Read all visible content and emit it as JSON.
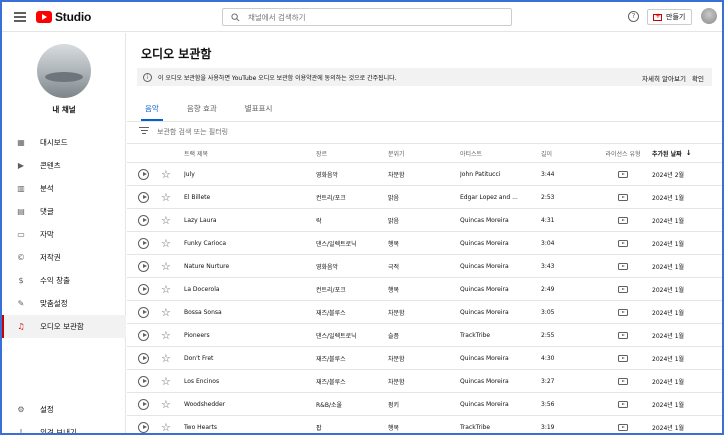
{
  "topbar": {
    "logo_text": "Studio",
    "search_placeholder": "채널에서 검색하기",
    "help": "?",
    "create_label": "만들기"
  },
  "sidebar": {
    "channel_name": "내 채널",
    "items": [
      {
        "label": "대시보드",
        "icon": "dashboard-icon"
      },
      {
        "label": "콘텐츠",
        "icon": "content-icon"
      },
      {
        "label": "분석",
        "icon": "analytics-icon"
      },
      {
        "label": "댓글",
        "icon": "comments-icon"
      },
      {
        "label": "자막",
        "icon": "subtitles-icon"
      },
      {
        "label": "저작권",
        "icon": "copyright-icon"
      },
      {
        "label": "수익 창출",
        "icon": "monetization-icon"
      },
      {
        "label": "맞춤설정",
        "icon": "customization-icon"
      },
      {
        "label": "오디오 보관함",
        "icon": "audio-library-icon",
        "active": true
      }
    ],
    "bottom_items": [
      {
        "label": "설정",
        "icon": "settings-icon"
      },
      {
        "label": "의견 보내기",
        "icon": "feedback-icon"
      }
    ]
  },
  "main": {
    "title": "오디오 보관함",
    "notice": {
      "text": "이 오디오 보관함을 사용하면 YouTube 오디오 보관함 이용약관에 동의하는 것으로 간주됩니다.",
      "learn_more": "자세히 알아보기",
      "confirm": "확인"
    },
    "tabs": [
      {
        "label": "음악",
        "active": true
      },
      {
        "label": "음향 효과",
        "active": false
      },
      {
        "label": "별표표시",
        "active": false
      }
    ],
    "filter_placeholder": "보관함 검색 또는 필터링",
    "columns": {
      "title": "트랙 제목",
      "genre": "장르",
      "mood": "분위기",
      "artist": "아티스트",
      "length": "길이",
      "license": "라이선스 유형",
      "date": "추가된 날짜"
    },
    "rows": [
      {
        "title": "July",
        "genre": "영화음악",
        "mood": "차분함",
        "artist": "John Patitucci",
        "length": "3:44",
        "date": "2024년 2월"
      },
      {
        "title": "El Billete",
        "genre": "컨트리/포크",
        "mood": "밝음",
        "artist": "Edgar Lopez and ...",
        "length": "2:53",
        "date": "2024년 1월"
      },
      {
        "title": "Lazy Laura",
        "genre": "락",
        "mood": "밝음",
        "artist": "Quincas Moreira",
        "length": "4:31",
        "date": "2024년 1월"
      },
      {
        "title": "Funky Carioca",
        "genre": "댄스/일렉트로닉",
        "mood": "행복",
        "artist": "Quincas Moreira",
        "length": "3:04",
        "date": "2024년 1월"
      },
      {
        "title": "Nature Nurture",
        "genre": "영화음악",
        "mood": "극적",
        "artist": "Quincas Moreira",
        "length": "3:43",
        "date": "2024년 1월"
      },
      {
        "title": "La Docerola",
        "genre": "컨트리/포크",
        "mood": "행복",
        "artist": "Quincas Moreira",
        "length": "2:49",
        "date": "2024년 1월"
      },
      {
        "title": "Bossa Sonsa",
        "genre": "재즈/블루스",
        "mood": "차분함",
        "artist": "Quincas Moreira",
        "length": "3:05",
        "date": "2024년 1월"
      },
      {
        "title": "Pioneers",
        "genre": "댄스/일렉트로닉",
        "mood": "슬픔",
        "artist": "TrackTribe",
        "length": "2:55",
        "date": "2024년 1월"
      },
      {
        "title": "Don't Fret",
        "genre": "재즈/블루스",
        "mood": "차분함",
        "artist": "Quincas Moreira",
        "length": "4:30",
        "date": "2024년 1월"
      },
      {
        "title": "Los Encinos",
        "genre": "재즈/블루스",
        "mood": "차분함",
        "artist": "Quincas Moreira",
        "length": "3:27",
        "date": "2024년 1월"
      },
      {
        "title": "Woodshedder",
        "genre": "R&B/소울",
        "mood": "펑키",
        "artist": "Quincas Moreira",
        "length": "3:56",
        "date": "2024년 1월"
      },
      {
        "title": "Two Hearts",
        "genre": "팝",
        "mood": "행복",
        "artist": "TrackTribe",
        "length": "3:19",
        "date": "2024년 1월"
      }
    ]
  },
  "colors": {
    "brand_red": "#ff0000",
    "active_red": "#cc0000",
    "tab_blue": "#065fd4"
  }
}
